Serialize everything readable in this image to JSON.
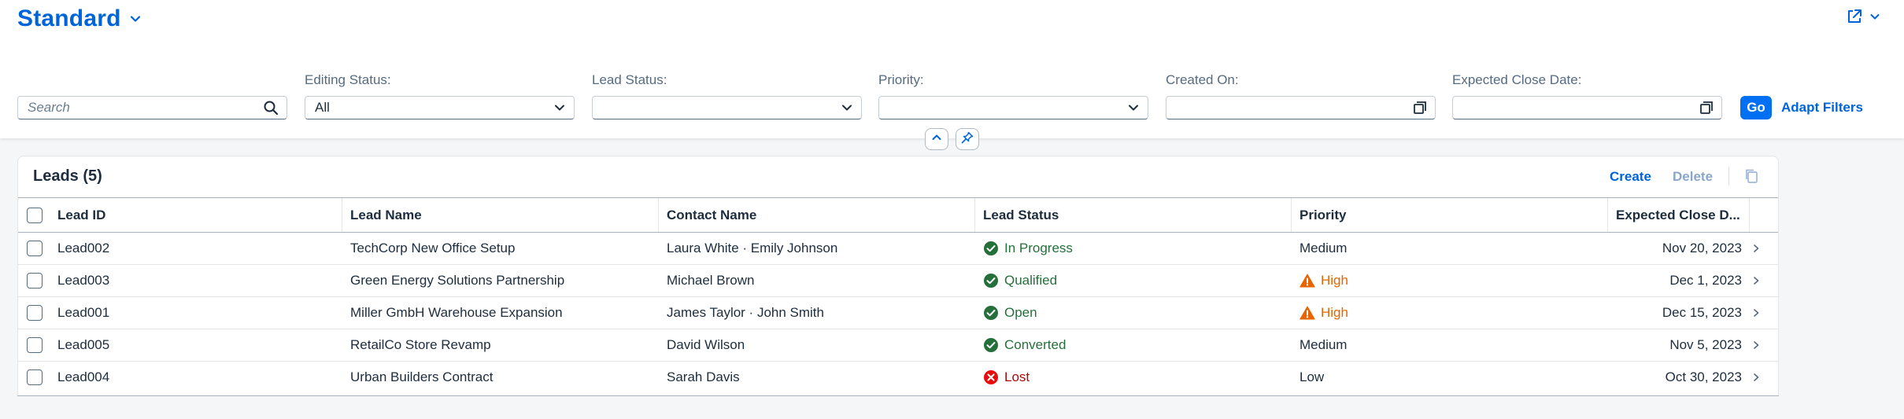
{
  "variant": {
    "title": "Standard"
  },
  "filter_bar": {
    "search": {
      "placeholder": "Search",
      "value": ""
    },
    "editing_status": {
      "label": "Editing Status:",
      "value": "All"
    },
    "lead_status": {
      "label": "Lead Status:",
      "value": ""
    },
    "priority": {
      "label": "Priority:",
      "value": ""
    },
    "created_on": {
      "label": "Created On:",
      "value": ""
    },
    "expected_close": {
      "label": "Expected Close Date:",
      "value": ""
    },
    "go_label": "Go",
    "adapt_label": "Adapt Filters"
  },
  "table": {
    "title": "Leads (5)",
    "create_label": "Create",
    "delete_label": "Delete",
    "columns": [
      "Lead ID",
      "Lead Name",
      "Contact Name",
      "Lead Status",
      "Priority",
      "Expected Close D..."
    ],
    "rows": [
      {
        "id": "Lead002",
        "name": "TechCorp New Office Setup",
        "contact": "Laura White · Emily Johnson",
        "status": "In Progress",
        "priority": "Medium",
        "close": "Nov 20, 2023"
      },
      {
        "id": "Lead003",
        "name": "Green Energy Solutions Partnership",
        "contact": "Michael Brown",
        "status": "Qualified",
        "priority": "High",
        "close": "Dec 1, 2023"
      },
      {
        "id": "Lead001",
        "name": "Miller GmbH Warehouse Expansion",
        "contact": "James Taylor · John Smith",
        "status": "Open",
        "priority": "High",
        "close": "Dec 15, 2023"
      },
      {
        "id": "Lead005",
        "name": "RetailCo Store Revamp",
        "contact": "David Wilson",
        "status": "Converted",
        "priority": "Medium",
        "close": "Nov 5, 2023"
      },
      {
        "id": "Lead004",
        "name": "Urban Builders Contract",
        "contact": "Sarah Davis",
        "status": "Lost",
        "priority": "Low",
        "close": "Oct 30, 2023"
      }
    ]
  },
  "colors": {
    "brand": "#0064d9",
    "emphasized_button": "#0070f2",
    "success": "#256f3a",
    "error": "#aa0808",
    "warning": "#e76500"
  }
}
